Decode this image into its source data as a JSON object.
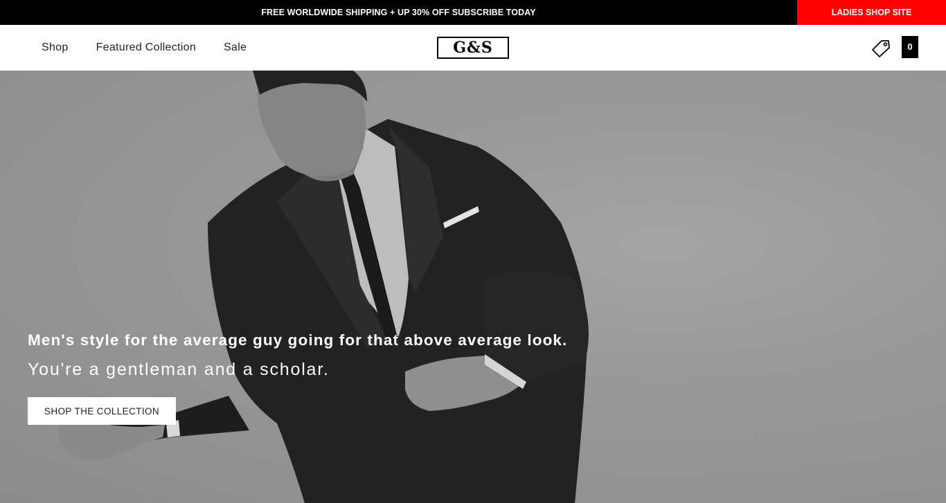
{
  "announcement": {
    "message": "FREE WORLDWIDE SHIPPING + UP 30% OFF SUBSCRIBE TODAY",
    "ladies_link": "LADIES SHOP SITE",
    "ladies_bg_color": "#ff0000"
  },
  "header": {
    "nav": [
      {
        "label": "Shop"
      },
      {
        "label": "Featured Collection"
      },
      {
        "label": "Sale"
      }
    ],
    "logo_text": "G&S",
    "wishlist_icon": "tag-icon",
    "cart_count": "0"
  },
  "hero": {
    "headline": "Men's style for the average guy going for that above average look.",
    "subheadline": "You're a gentleman and a scholar.",
    "cta_label": "SHOP THE COLLECTION",
    "image_description_icon": "man-in-suit-photo"
  }
}
